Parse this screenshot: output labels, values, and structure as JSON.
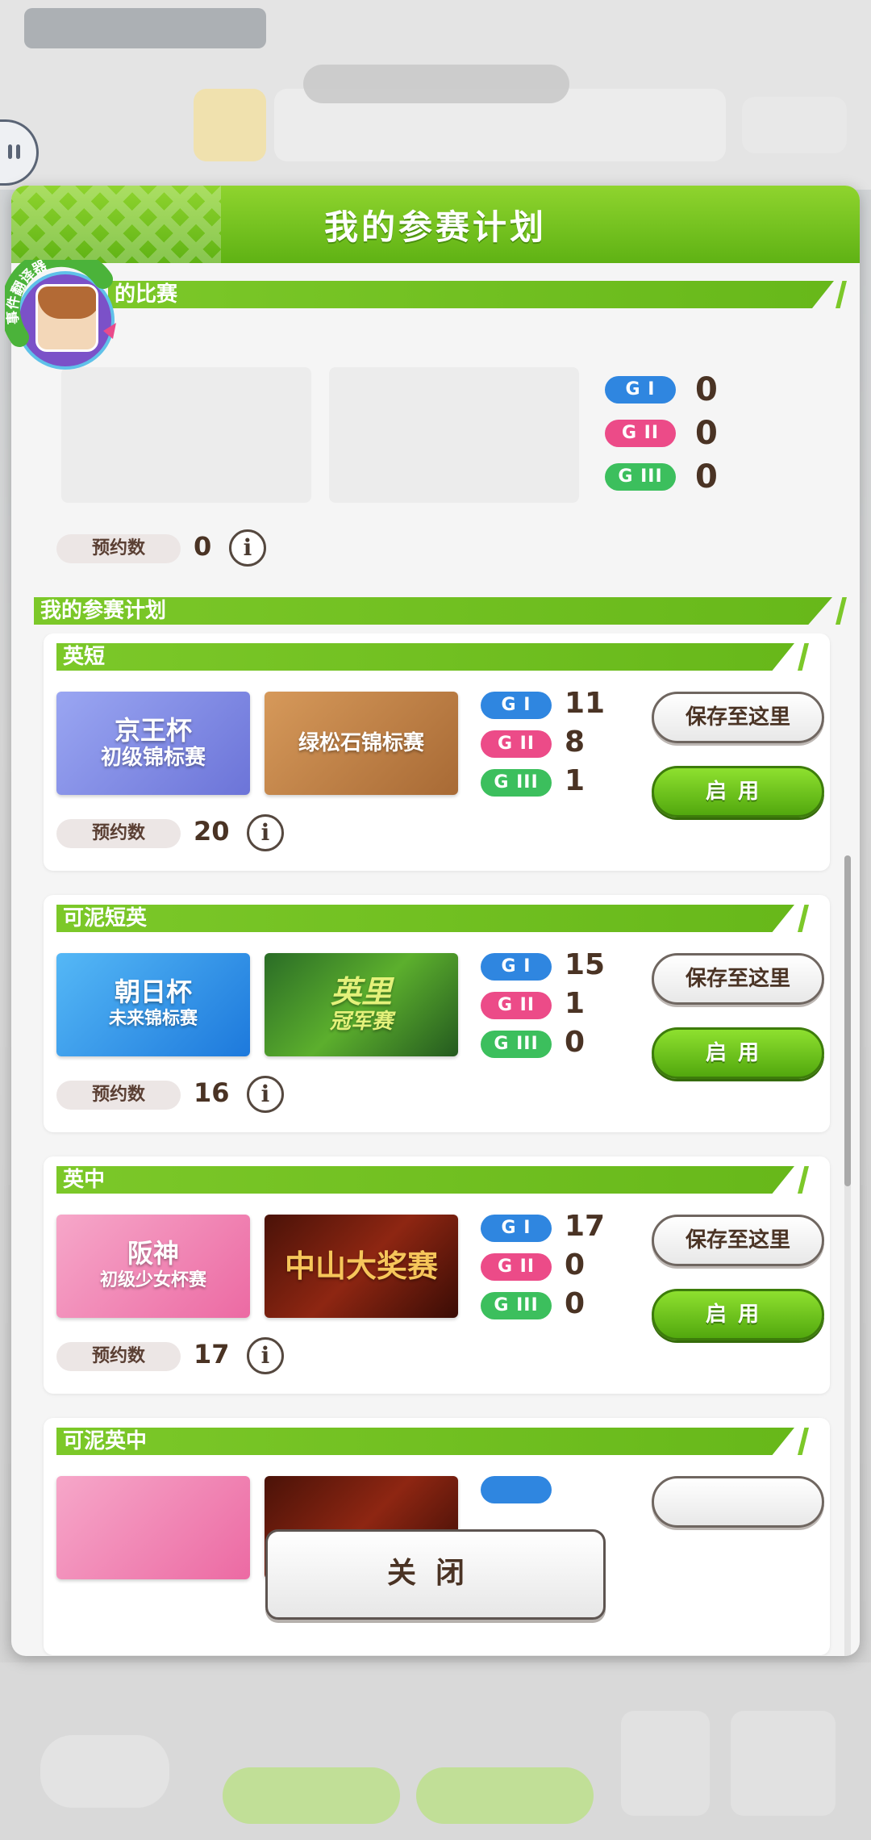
{
  "modal": {
    "title": "我的参赛计划",
    "reserved_section_title": "的比赛",
    "reserved": {
      "grades": [
        {
          "label": "G I",
          "count": "0"
        },
        {
          "label": "G II",
          "count": "0"
        },
        {
          "label": "G III",
          "count": "0"
        }
      ],
      "reservation_label": "预约数",
      "reservation_count": "0"
    },
    "plans_section_title": "我的参赛计划",
    "plans": [
      {
        "name": "英短",
        "banners": [
          {
            "line1": "京王杯",
            "line2": "初级锦标赛"
          },
          {
            "line1": "绿松石锦标赛",
            "line2": ""
          }
        ],
        "grades": [
          {
            "label": "G I",
            "count": "11"
          },
          {
            "label": "G II",
            "count": "8"
          },
          {
            "label": "G III",
            "count": "1"
          }
        ],
        "reservation_label": "预约数",
        "reservation_count": "20",
        "save_label": "保存至这里",
        "enable_label": "启用"
      },
      {
        "name": "可泥短英",
        "banners": [
          {
            "line1": "朝日杯",
            "line2": "未来锦标赛"
          },
          {
            "line1": "英里",
            "line2": "冠军赛"
          }
        ],
        "grades": [
          {
            "label": "G I",
            "count": "15"
          },
          {
            "label": "G II",
            "count": "1"
          },
          {
            "label": "G III",
            "count": "0"
          }
        ],
        "reservation_label": "预约数",
        "reservation_count": "16",
        "save_label": "保存至这里",
        "enable_label": "启用"
      },
      {
        "name": "英中",
        "banners": [
          {
            "line1": "阪神",
            "line2": "初级少女杯赛"
          },
          {
            "line1": "中山大奖赛",
            "line2": ""
          }
        ],
        "grades": [
          {
            "label": "G I",
            "count": "17"
          },
          {
            "label": "G II",
            "count": "0"
          },
          {
            "label": "G III",
            "count": "0"
          }
        ],
        "reservation_label": "预约数",
        "reservation_count": "17",
        "save_label": "保存至这里",
        "enable_label": "启用"
      },
      {
        "name": "可泥英中"
      }
    ],
    "close_label": "关闭"
  },
  "mascot_badge": "事件翻译器",
  "colors": {
    "accent_green": "#6bbd1e",
    "grade1_blue": "#2f86e0",
    "grade2_pink": "#ec4b88",
    "grade3_green": "#3cbf5d",
    "text_brown": "#4a3324"
  }
}
